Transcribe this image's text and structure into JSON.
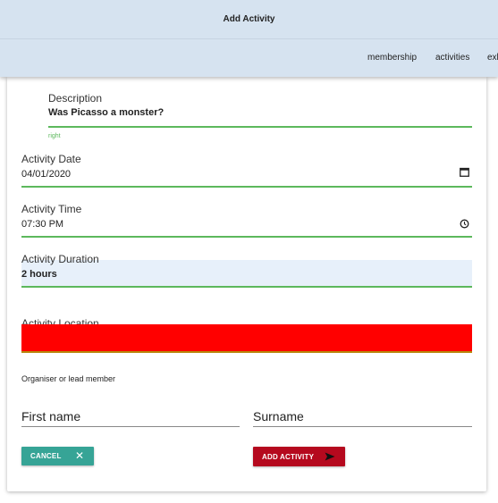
{
  "header": {
    "title": "Add Activity",
    "nav": [
      "membership",
      "activities",
      "exh"
    ]
  },
  "form": {
    "description": {
      "label": "Description",
      "value": "Was Picasso a monster?",
      "hint": "right"
    },
    "date": {
      "label": "Activity Date",
      "value": "04/01/2020"
    },
    "time": {
      "label": "Activity Time",
      "value": "07:30 PM"
    },
    "duration": {
      "label": "Activity Duration",
      "value": "2 hours"
    },
    "location": {
      "label": "Activity Location",
      "value": ""
    },
    "organiser_label": "Organiser or lead member",
    "first_name_label": "First name",
    "surname_label": "Surname"
  },
  "buttons": {
    "cancel": "CANCEL",
    "add": "ADD ACTIVITY"
  },
  "colors": {
    "appbar": "#d6e3f0",
    "valid": "#5cb85c",
    "cancel": "#36a496",
    "add": "#b5091e",
    "error_fill": "#ff0000"
  },
  "icons": [
    "calendar-icon",
    "clock-icon",
    "close-icon",
    "send-icon"
  ]
}
